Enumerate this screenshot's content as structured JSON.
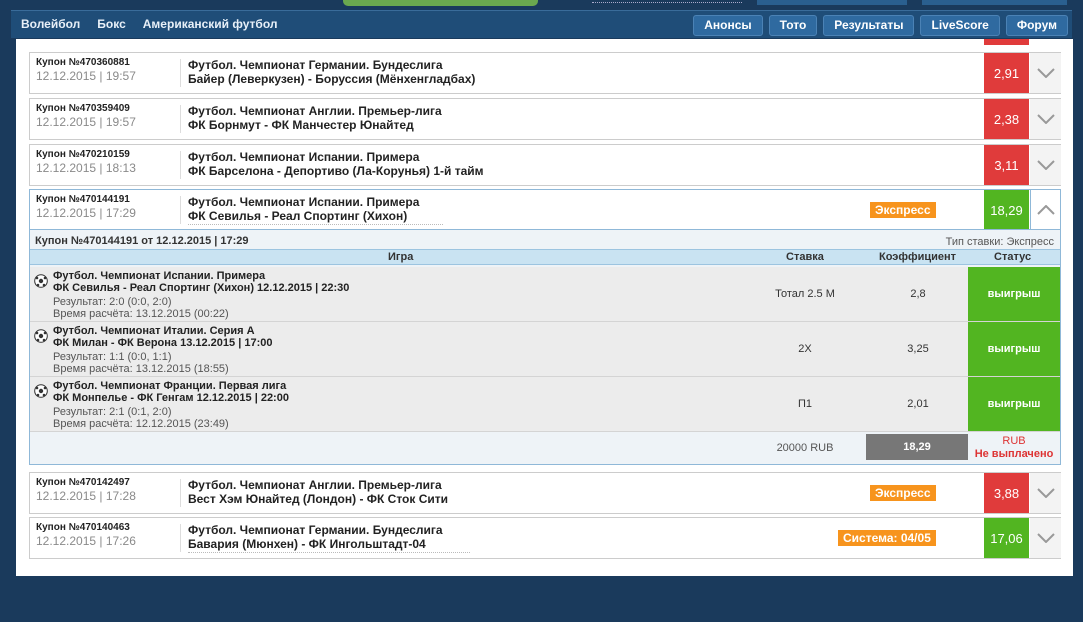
{
  "nav": {
    "left": [
      "Волейбол",
      "Бокс",
      "Американский футбол"
    ],
    "right": [
      "Анонсы",
      "Тото",
      "Результаты",
      "LiveScore",
      "Форум"
    ]
  },
  "coupons": [
    {
      "number": "Купон №470360881",
      "date": "12.12.2015 | 19:57",
      "line1": "Футбол. Чемпионат Германии. Бундеслига",
      "line2": "Байер (Леверкузен) - Боруссия (Мёнхенгладбах)",
      "odds": "2,91",
      "color": "#e03b3b"
    },
    {
      "number": "Купон №470359409",
      "date": "12.12.2015 | 19:57",
      "line1": "Футбол. Чемпионат Англии. Премьер-лига",
      "line2": "ФК Борнмут - ФК Манчестер Юнайтед",
      "odds": "2,38",
      "color": "#e03b3b"
    },
    {
      "number": "Купон №470210159",
      "date": "12.12.2015 | 18:13",
      "line1": "Футбол. Чемпионат Испании. Примера",
      "line2": "ФК Барселона - Депортиво (Ла-Корунья) 1-й тайм",
      "odds": "3,11",
      "color": "#e03b3b"
    },
    {
      "number": "Купон №470144191",
      "date": "12.12.2015 | 17:29",
      "line1": "Футбол. Чемпионат Испании. Примера",
      "line2": "ФК Севилья - Реал Спортинг (Хихон)",
      "tag": "Экспресс",
      "odds": "18,29",
      "color": "#52b521"
    },
    {
      "number": "Купон №470142497",
      "date": "12.12.2015 | 17:28",
      "line1": "Футбол. Чемпионат Англии. Премьер-лига",
      "line2": "Вест Хэм Юнайтед (Лондон) - ФК Сток Сити",
      "tag": "Экспресс",
      "odds": "3,88",
      "color": "#e03b3b"
    },
    {
      "number": "Купон №470140463",
      "date": "12.12.2015 | 17:26",
      "line1": "Футбол. Чемпионат Германии. Бундеслига",
      "line2": "Бавария (Мюнхен) - ФК Ингольштадт-04",
      "tag": "Система: 04/05",
      "odds": "17,06",
      "color": "#52b521"
    }
  ],
  "details": {
    "header": "Купон №470144191 от 12.12.2015 | 17:29",
    "bet_type": "Тип ставки: Экспресс",
    "columns": [
      "Игра",
      "Ставка",
      "Коэффициент",
      "Статус"
    ],
    "rows": [
      {
        "line1": "Футбол. Чемпионат Испании. Примера",
        "line2": "ФК Севилья - Реал Спортинг (Хихон) 12.12.2015 | 22:30",
        "result": "Результат: 2:0 (0:0, 2:0)",
        "calc": "Время расчёта: 13.12.2015 (00:22)",
        "stake": "Тотал 2.5 М",
        "coef": "2,8",
        "status": "выигрыш"
      },
      {
        "line1": "Футбол. Чемпионат Италии. Серия А",
        "line2": "ФК Милан - ФК Верона 13.12.2015 | 17:00",
        "result": "Результат: 1:1 (0:0, 1:1)",
        "calc": "Время расчёта: 13.12.2015 (18:55)",
        "stake": "2X",
        "coef": "3,25",
        "status": "выигрыш"
      },
      {
        "line1": "Футбол. Чемпионат Франции. Первая лига",
        "line2": "ФК Монпелье - ФК Генгам 12.12.2015 | 22:00",
        "result": "Результат: 2:1 (0:1, 2:0)",
        "calc": "Время расчёта: 12.12.2015 (23:49)",
        "stake": "П1",
        "coef": "2,01",
        "status": "выигрыш"
      }
    ],
    "total_sum": "20000 RUB",
    "total_coef": "18,29",
    "currency": "RUB",
    "payout_status": "Не выплачено"
  }
}
